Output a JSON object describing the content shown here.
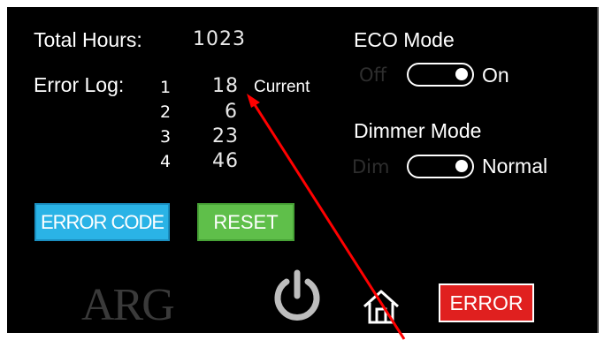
{
  "header": {
    "total_hours_label": "Total Hours:",
    "total_hours_value": "1023",
    "error_log_label": "Error Log:"
  },
  "error_log": [
    {
      "index": "1",
      "value": "18",
      "note": "Current"
    },
    {
      "index": "2",
      "value": "6",
      "note": ""
    },
    {
      "index": "3",
      "value": "23",
      "note": ""
    },
    {
      "index": "4",
      "value": "46",
      "note": ""
    }
  ],
  "eco_mode": {
    "title": "ECO Mode",
    "off_label": "Off",
    "on_label": "On",
    "state": "On"
  },
  "dimmer_mode": {
    "title": "Dimmer Mode",
    "off_label": "Dim",
    "on_label": "Normal",
    "state": "Normal"
  },
  "buttons": {
    "error_code": "ERROR CODE",
    "reset": "RESET",
    "error": "ERROR"
  },
  "logo_text": "ARG",
  "icons": [
    "power-icon",
    "home-icon"
  ],
  "colors": {
    "error_code_bg": "#2ab3e6",
    "reset_bg": "#5fbf4a",
    "error_bg": "#e0201f",
    "annotation_arrow": "#ff0000"
  }
}
